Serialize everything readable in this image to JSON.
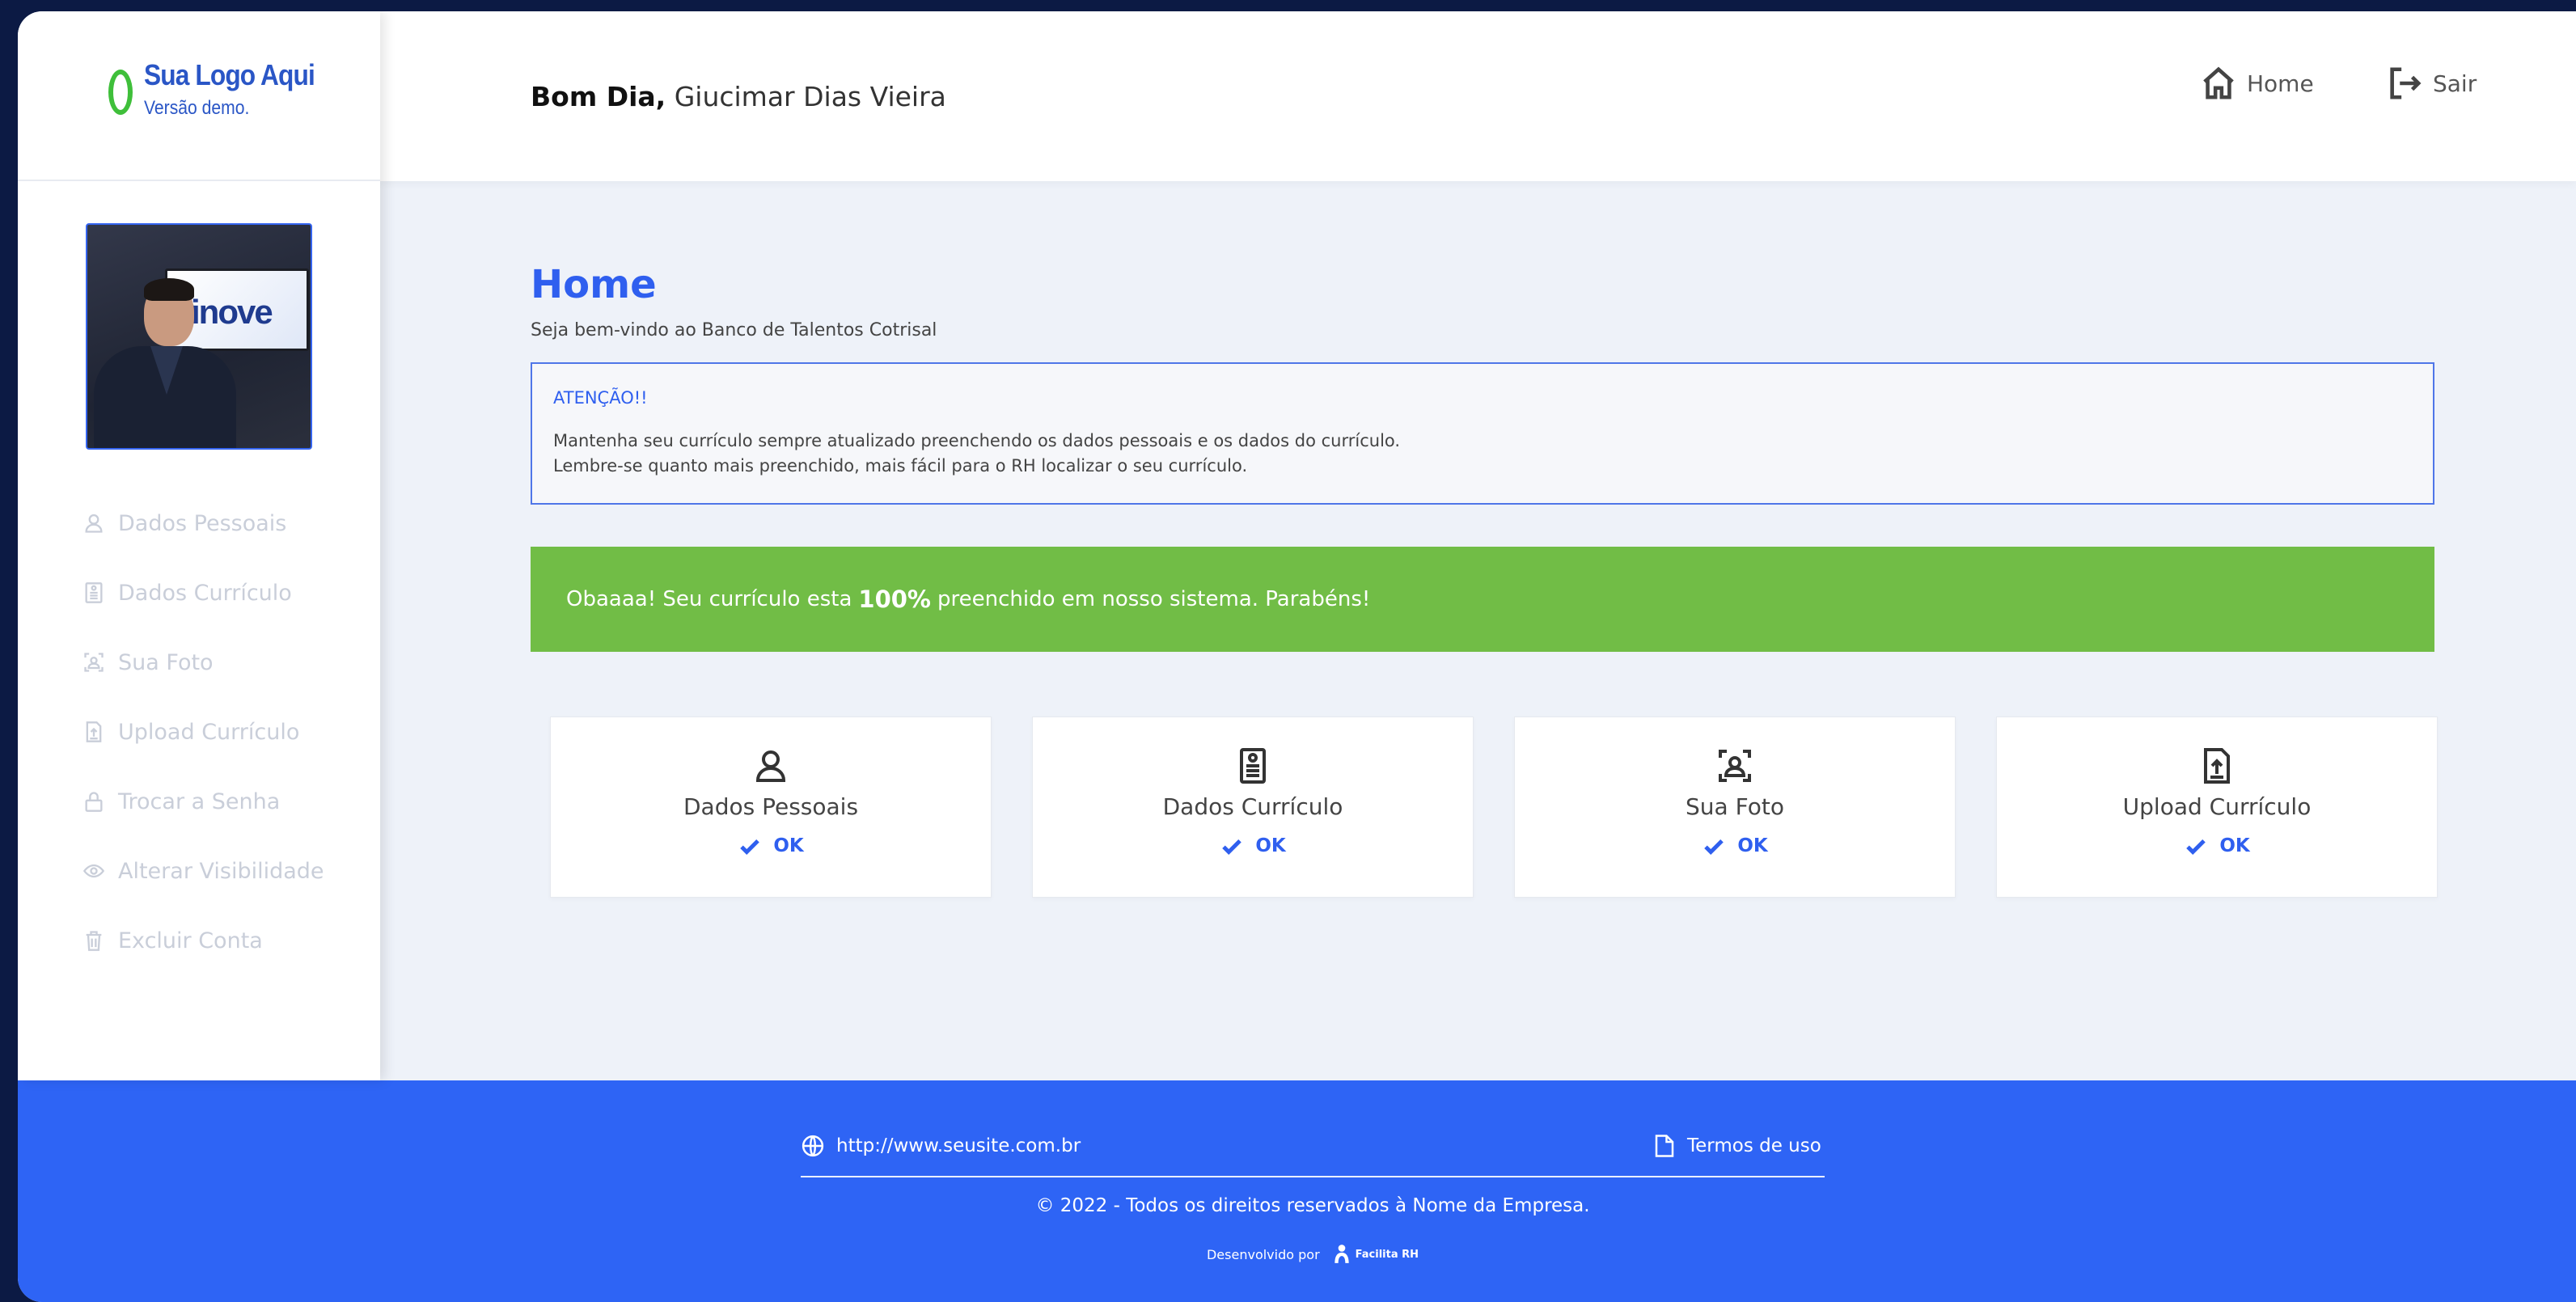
{
  "logo": {
    "title": "Sua Logo Aqui",
    "subtitle": "Versão demo."
  },
  "profile": {
    "photo_text": "inove"
  },
  "sidebar": {
    "items": [
      {
        "label": "Dados Pessoais",
        "icon": "user-icon"
      },
      {
        "label": "Dados Currículo",
        "icon": "document-list-icon"
      },
      {
        "label": "Sua Foto",
        "icon": "camera-frame-icon"
      },
      {
        "label": "Upload Currículo",
        "icon": "upload-file-icon"
      },
      {
        "label": "Trocar a Senha",
        "icon": "lock-icon"
      },
      {
        "label": "Alterar Visibilidade",
        "icon": "eye-icon"
      },
      {
        "label": "Excluir Conta",
        "icon": "trash-icon"
      }
    ]
  },
  "header": {
    "greeting_bold": "Bom Dia,",
    "user_name": "Giucimar Dias Vieira",
    "home_label": "Home",
    "logout_label": "Sair"
  },
  "main": {
    "title": "Home",
    "subtitle": "Seja bem-vindo ao Banco de Talentos Cotrisal",
    "alert": {
      "title": "ATENÇÃO!!",
      "line1": "Mantenha seu currículo sempre atualizado preenchendo os dados pessoais e os dados do currículo.",
      "line2": "Lembre-se quanto mais preenchido, mais fácil para o RH localizar o seu currículo."
    },
    "progress": {
      "prefix": "Obaaaa! Seu currículo esta",
      "percent": "100%",
      "suffix": "preenchido em nosso sistema. Parabéns!",
      "value_percent": 100
    },
    "cards": [
      {
        "label": "Dados Pessoais",
        "status": "OK",
        "icon": "user-icon"
      },
      {
        "label": "Dados Currículo",
        "status": "OK",
        "icon": "document-list-icon"
      },
      {
        "label": "Sua Foto",
        "status": "OK",
        "icon": "camera-frame-icon"
      },
      {
        "label": "Upload Currículo",
        "status": "OK",
        "icon": "upload-file-icon"
      }
    ]
  },
  "footer": {
    "site": "http://www.seusite.com.br",
    "terms": "Termos de uso",
    "copyright": "© 2022 - Todos os direitos reservados à Nome da Empresa.",
    "developed_by": "Desenvolvido por",
    "brand": "Facilita RH"
  },
  "colors": {
    "accent": "#2f5fef",
    "success": "#71bd46",
    "footer_bg": "#2e64f5",
    "page_bg": "#eef2f9",
    "outer_bg": "#0c1a44",
    "logo_green": "#3fbf3a"
  }
}
